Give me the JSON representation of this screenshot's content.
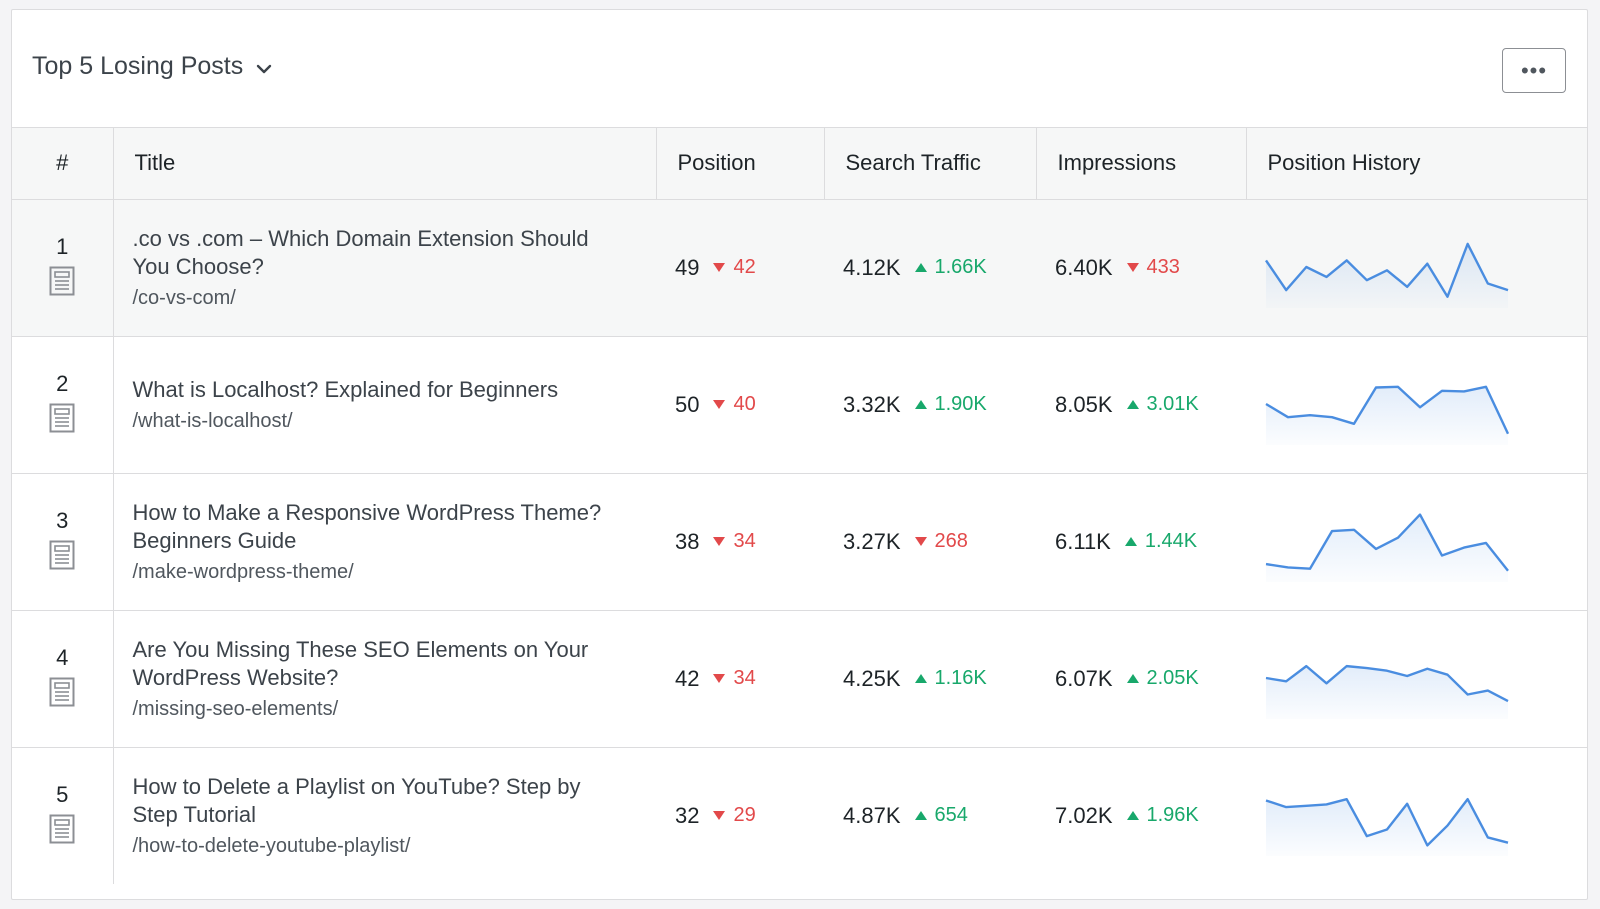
{
  "header": {
    "title": "Top 5 Losing Posts",
    "more_label": "•••"
  },
  "columns": [
    "#",
    "Title",
    "Position",
    "Search Traffic",
    "Impressions",
    "Position History"
  ],
  "colors": {
    "up": "#18a86b",
    "down": "#e2494a",
    "spark": "#4a8de0"
  },
  "rows": [
    {
      "index": "1",
      "title": ".co vs .com – Which Domain Extension Should You Choose?",
      "url": "/co-vs-com/",
      "position": {
        "value": "49",
        "change": "42",
        "dir": "down"
      },
      "traffic": {
        "value": "4.12K",
        "change": "1.66K",
        "dir": "up"
      },
      "impressions": {
        "value": "6.40K",
        "change": "433",
        "dir": "down"
      },
      "history": [
        6,
        1.5,
        5,
        3.5,
        6,
        3,
        4.5,
        2,
        5.5,
        0.5,
        8.5,
        2.5,
        1.5
      ]
    },
    {
      "index": "2",
      "title": "What is Localhost? Explained for Beginners",
      "url": "/what-is-localhost/",
      "position": {
        "value": "50",
        "change": "40",
        "dir": "down"
      },
      "traffic": {
        "value": "3.32K",
        "change": "1.90K",
        "dir": "up"
      },
      "impressions": {
        "value": "8.05K",
        "change": "3.01K",
        "dir": "up"
      },
      "history": [
        5,
        3,
        3.3,
        3,
        2,
        7.5,
        7.6,
        4.5,
        7,
        6.9,
        7.6,
        0.5
      ]
    },
    {
      "index": "3",
      "title": "How to Make a Responsive WordPress Theme? Beginners Guide",
      "url": "/make-wordpress-theme/",
      "position": {
        "value": "38",
        "change": "34",
        "dir": "down"
      },
      "traffic": {
        "value": "3.27K",
        "change": "268",
        "dir": "down"
      },
      "impressions": {
        "value": "6.11K",
        "change": "1.44K",
        "dir": "up"
      },
      "history": [
        1.5,
        1,
        0.8,
        6.5,
        6.7,
        3.8,
        5.5,
        9,
        2.8,
        4,
        4.7,
        0.5
      ]
    },
    {
      "index": "4",
      "title": "Are You Missing These SEO Elements on Your WordPress Website?",
      "url": "/missing-seo-elements/",
      "position": {
        "value": "42",
        "change": "34",
        "dir": "down"
      },
      "traffic": {
        "value": "4.25K",
        "change": "1.16K",
        "dir": "up"
      },
      "impressions": {
        "value": "6.07K",
        "change": "2.05K",
        "dir": "up"
      },
      "history": [
        5,
        4.5,
        6.8,
        4.2,
        6.8,
        6.5,
        6.1,
        5.3,
        6.4,
        5.5,
        2.5,
        3.1,
        1.5
      ]
    },
    {
      "index": "5",
      "title": "How to Delete a Playlist on YouTube? Step by Step Tutorial",
      "url": "/how-to-delete-youtube-playlist/",
      "position": {
        "value": "32",
        "change": "29",
        "dir": "down"
      },
      "traffic": {
        "value": "4.87K",
        "change": "654",
        "dir": "up"
      },
      "impressions": {
        "value": "7.02K",
        "change": "1.96K",
        "dir": "up"
      },
      "history": [
        7.2,
        6.2,
        6.4,
        6.6,
        7.4,
        1.8,
        2.8,
        6.7,
        0.4,
        3.4,
        7.4,
        1.6,
        0.8
      ]
    }
  ]
}
